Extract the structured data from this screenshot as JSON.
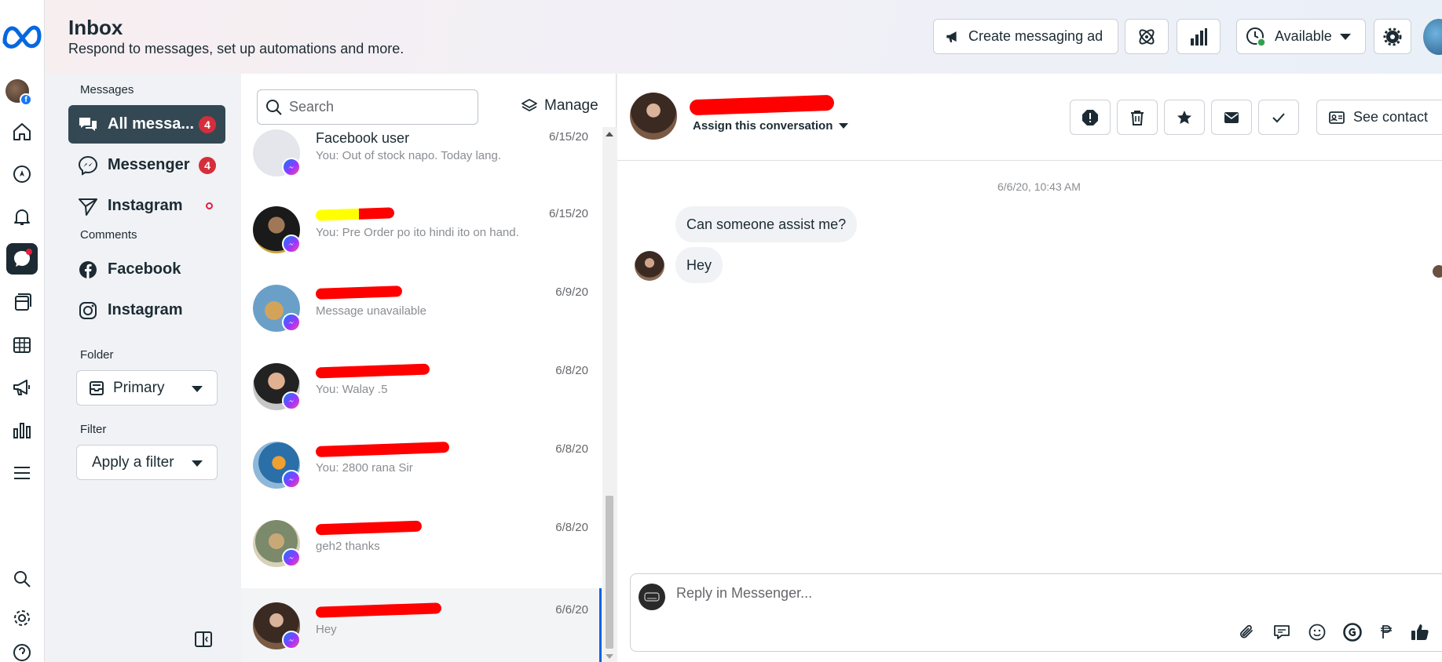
{
  "header": {
    "title": "Inbox",
    "subtitle": "Respond to messages, set up automations and more.",
    "create_ad_label": "Create messaging ad",
    "status_label": "Available"
  },
  "rail": {
    "icons": [
      "home-icon",
      "compass-icon",
      "bell-icon",
      "inbox-chat-icon",
      "pages-icon",
      "table-icon",
      "megaphone-icon",
      "insights-icon",
      "menu-icon",
      "search-icon",
      "settings-icon",
      "help-icon"
    ],
    "fb_badge": "f"
  },
  "nav": {
    "messages_heading": "Messages",
    "all_messages": {
      "label": "All messa...",
      "count": "4"
    },
    "messenger": {
      "label": "Messenger",
      "count": "4"
    },
    "instagram_messages": {
      "label": "Instagram"
    },
    "comments_heading": "Comments",
    "facebook_comments": {
      "label": "Facebook"
    },
    "instagram_comments": {
      "label": "Instagram"
    },
    "folder_heading": "Folder",
    "folder_value": "Primary",
    "filter_heading": "Filter",
    "filter_value": "Apply a filter"
  },
  "list": {
    "search_placeholder": "Search",
    "manage_label": "Manage",
    "conversations": [
      {
        "name": "Facebook user",
        "preview": "You: Out of stock napo. Today lang.",
        "date": "6/15/20",
        "name_redacted": false
      },
      {
        "name": "",
        "preview": "You: Pre Order po ito hindi ito on hand.",
        "date": "6/15/20",
        "name_redacted": true
      },
      {
        "name": "",
        "preview": "Message unavailable",
        "date": "6/9/20",
        "name_redacted": true
      },
      {
        "name": "",
        "preview": "You: Walay .5",
        "date": "6/8/20",
        "name_redacted": true
      },
      {
        "name": "",
        "preview": "You: 2800 rana Sir",
        "date": "6/8/20",
        "name_redacted": true
      },
      {
        "name": "",
        "preview": "geh2 thanks",
        "date": "6/8/20",
        "name_redacted": true
      },
      {
        "name": "",
        "preview": "Hey",
        "date": "6/6/20",
        "name_redacted": true,
        "selected": true
      }
    ]
  },
  "conversation": {
    "assign_label": "Assign this conversation",
    "see_contact_label": "See contact",
    "timestamp": "6/6/20, 10:43 AM",
    "messages": [
      {
        "text": "Can someone assist me?"
      },
      {
        "text": "Hey"
      }
    ],
    "reply_placeholder": "Reply in Messenger...",
    "composer_tools": [
      "paperclip-icon",
      "saved-reply-icon",
      "emoji-icon",
      "gif-icon",
      "peso-icon",
      "thumbs-up-icon"
    ]
  },
  "colors": {
    "accent": "#0064e0",
    "nav_active": "#344854",
    "badge": "#d52e3b",
    "redaction": "#ff0000"
  }
}
